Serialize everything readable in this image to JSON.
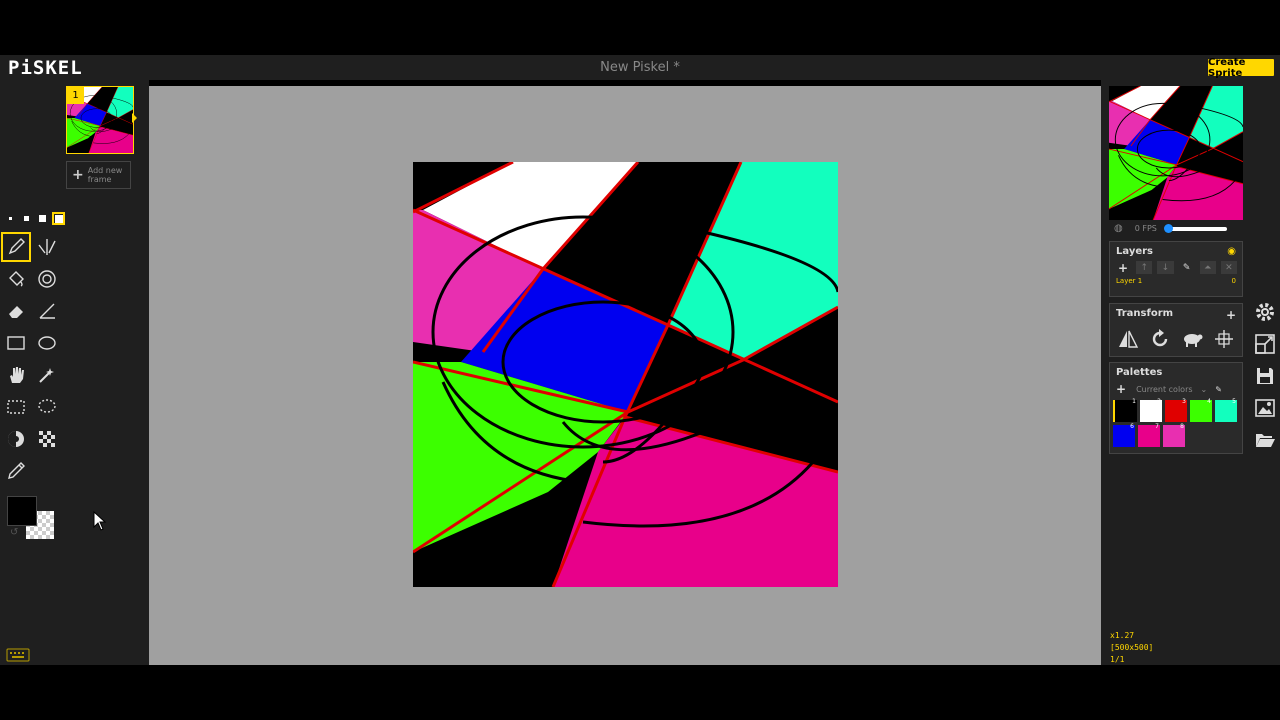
{
  "app": {
    "logo": "PiSKEL",
    "document_title": "New Piskel *",
    "create_button": "Create Sprite"
  },
  "frames": {
    "current_index": "1",
    "add_frame_label": "Add new frame"
  },
  "tools": {
    "pen_sizes": 4,
    "items": [
      "pen-tool",
      "mirror-pen-tool",
      "paint-bucket-tool",
      "paint-all-same-color-tool",
      "eraser-tool",
      "stroke-tool",
      "rectangle-tool",
      "ellipse-tool",
      "move-tool",
      "shape-selection-tool",
      "rectangle-selection-tool",
      "lasso-selection-tool",
      "lighten-tool",
      "dithering-tool",
      "color-picker-tool"
    ],
    "primary_color": "#000000",
    "secondary_color": "transparent"
  },
  "preview": {
    "fps_label": "0 FPS",
    "fps_value": 0
  },
  "layers": {
    "title": "Layers",
    "items": [
      {
        "name": "Layer 1",
        "opacity": "0"
      }
    ]
  },
  "transform": {
    "title": "Transform",
    "tools": [
      "flip-icon",
      "rotate-icon",
      "sheep-icon",
      "center-icon"
    ]
  },
  "palettes": {
    "title": "Palettes",
    "selected": "Current colors",
    "colors": [
      {
        "num": "1",
        "hex": "transparent"
      },
      {
        "num": "2",
        "hex": "#ffffff"
      },
      {
        "num": "3",
        "hex": "#e00000"
      },
      {
        "num": "4",
        "hex": "#3cff00"
      },
      {
        "num": "5",
        "hex": "#12ffbe"
      },
      {
        "num": "6",
        "hex": "#0000f0"
      },
      {
        "num": "7",
        "hex": "#e8008a"
      },
      {
        "num": "8",
        "hex": "#e82fb0"
      }
    ]
  },
  "status": {
    "zoom": "x1.27",
    "size": "[500x500]",
    "frame": "1/1"
  },
  "colors": {
    "accent": "#ffd700",
    "panel": "#1f1f1f",
    "stage": "#a0a0a0"
  }
}
